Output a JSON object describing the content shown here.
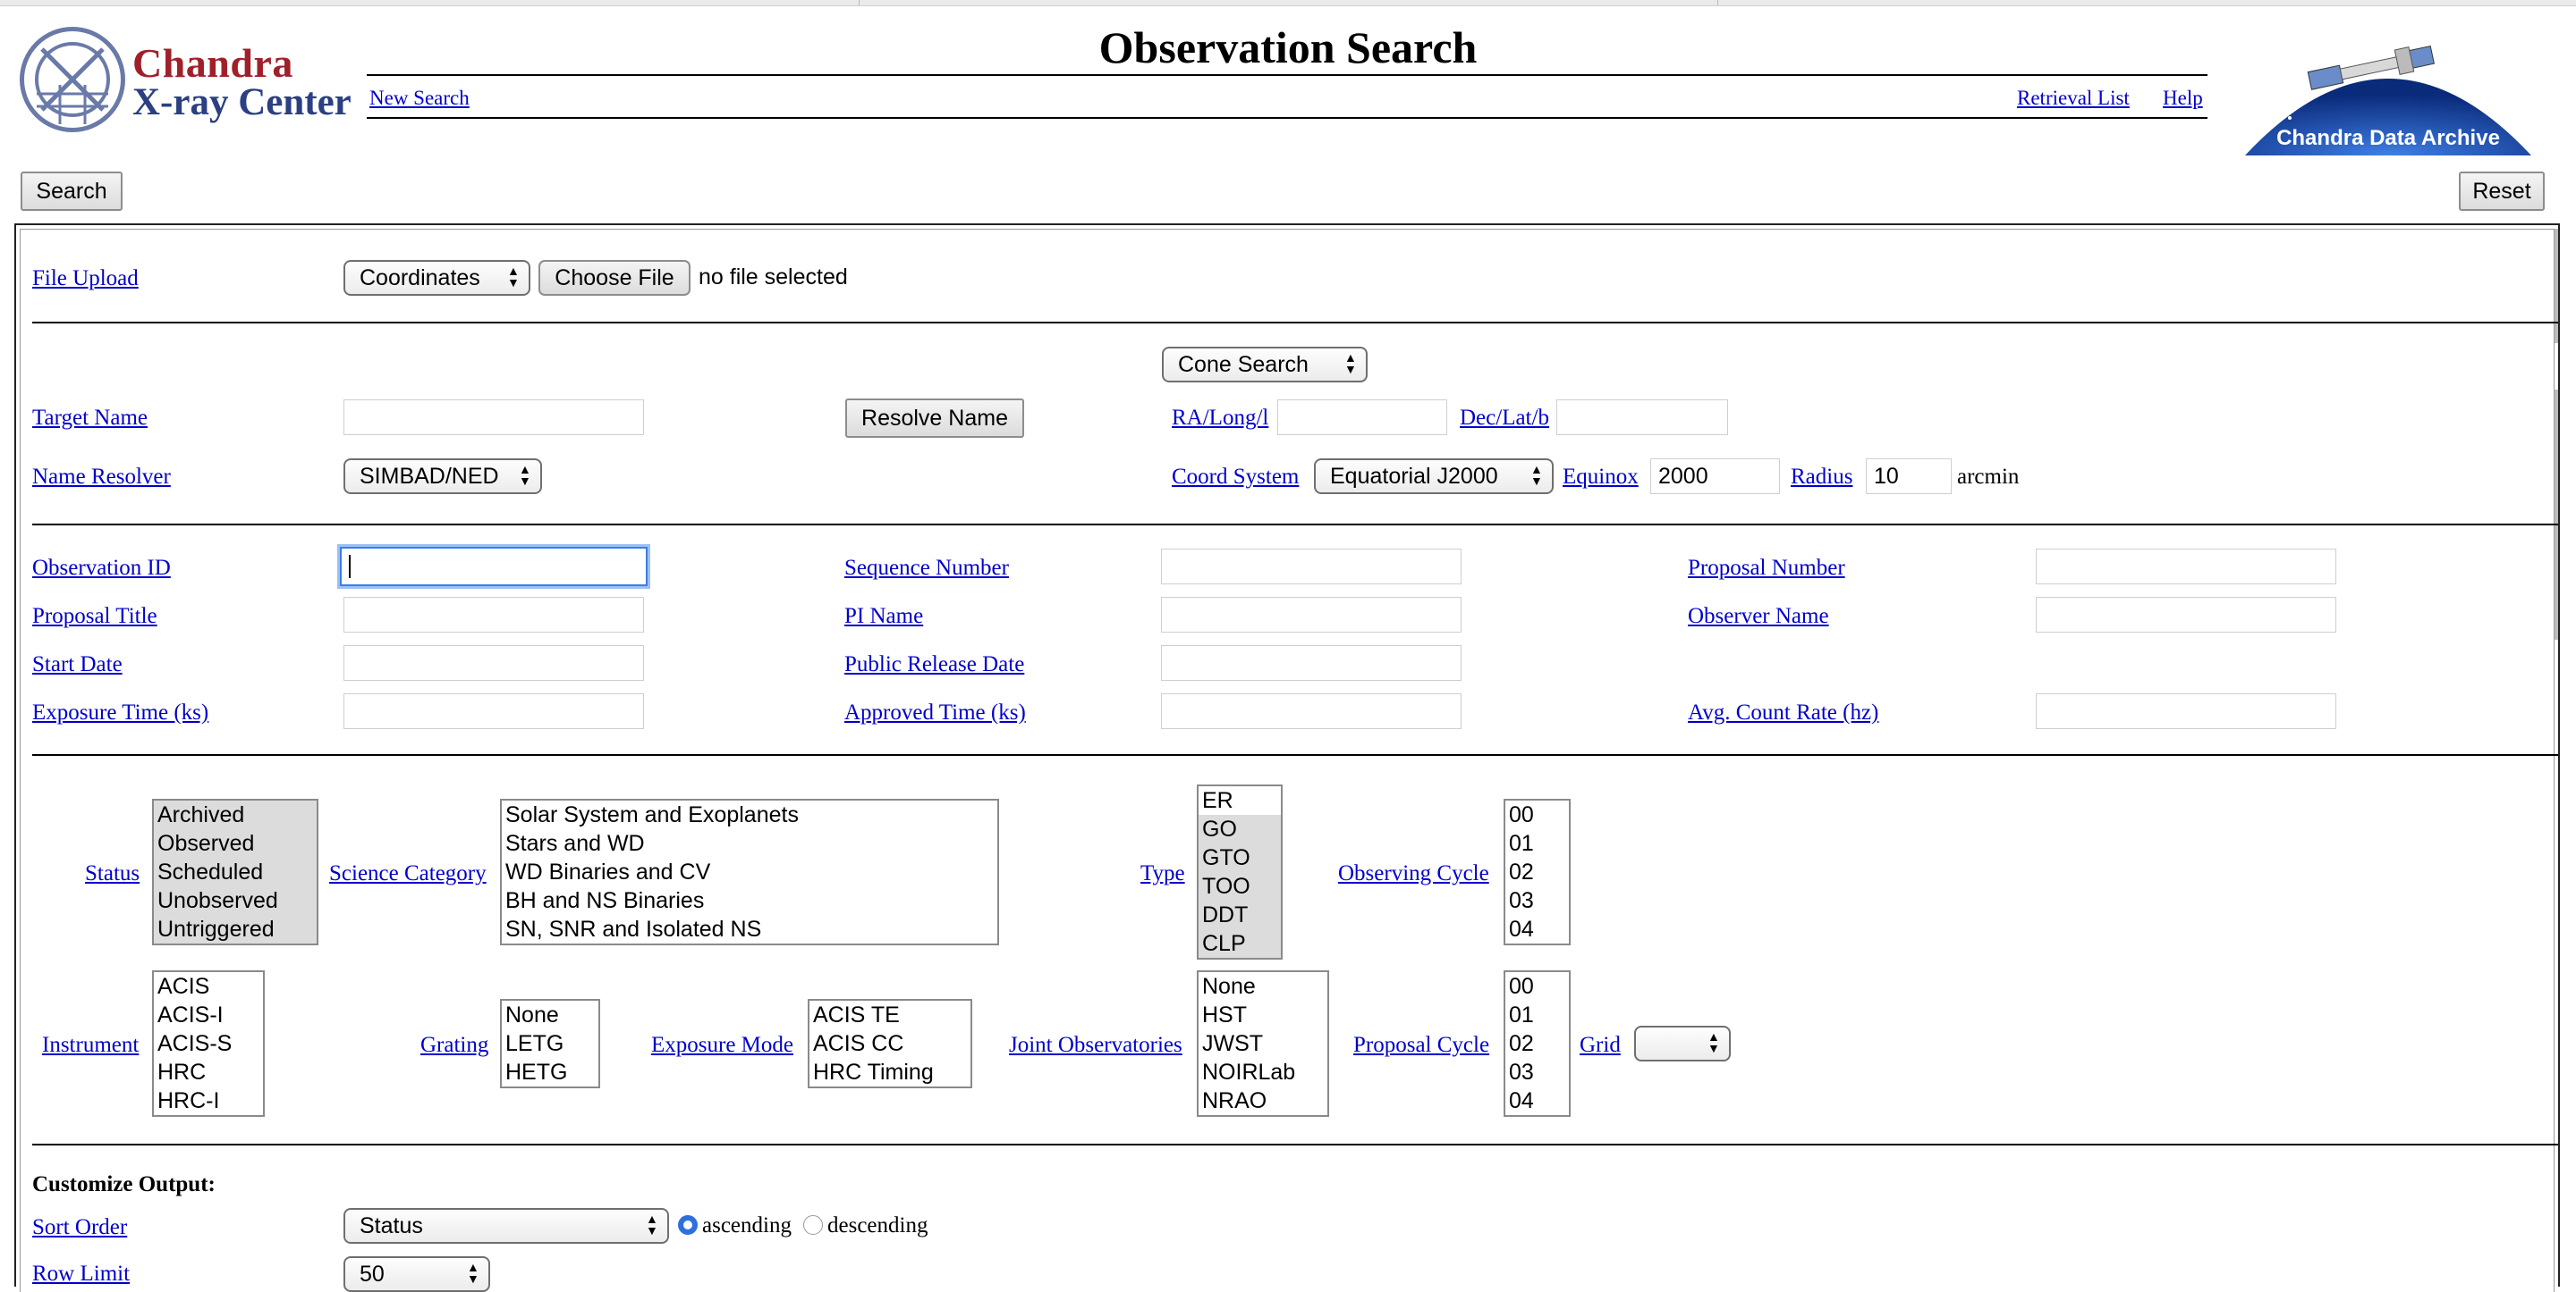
{
  "header": {
    "logo_line1": "Chandra",
    "logo_line2": "X-ray Center",
    "title": "Observation Search",
    "new_search": "New Search",
    "retrieval_list": "Retrieval List",
    "help": "Help",
    "archive_label": "Chandra Data Archive"
  },
  "actions": {
    "search": "Search",
    "reset": "Reset"
  },
  "upload": {
    "label": "File Upload",
    "type_select": "Coordinates",
    "choose_file": "Choose File",
    "file_status": "no file selected"
  },
  "target": {
    "search_mode": "Cone Search",
    "target_name_label": "Target Name",
    "target_name_value": "",
    "resolve_button": "Resolve Name",
    "ra_label": "RA/Long/l",
    "ra_value": "",
    "dec_label": "Dec/Lat/b",
    "dec_value": "",
    "name_resolver_label": "Name Resolver",
    "name_resolver_value": "SIMBAD/NED",
    "coord_system_label": "Coord System",
    "coord_system_value": "Equatorial J2000",
    "equinox_label": "Equinox",
    "equinox_value": "2000",
    "radius_label": "Radius",
    "radius_value": "10",
    "radius_unit": "arcmin"
  },
  "fields": {
    "observation_id": "Observation ID",
    "sequence_number": "Sequence Number",
    "proposal_number": "Proposal Number",
    "proposal_title": "Proposal Title",
    "pi_name": "PI Name",
    "observer_name": "Observer Name",
    "start_date": "Start Date",
    "public_release_date": "Public Release Date",
    "exposure_time": "Exposure Time (ks)",
    "approved_time": "Approved Time (ks)",
    "avg_count_rate": "Avg. Count Rate (hz)"
  },
  "lists": {
    "status_label": "Status",
    "status": [
      "Archived",
      "Observed",
      "Scheduled",
      "Unobserved",
      "Untriggered"
    ],
    "science_category_label": "Science Category",
    "science_category": [
      "Solar System and Exoplanets",
      "Stars and WD",
      "WD Binaries and CV",
      "BH and NS Binaries",
      "SN, SNR and Isolated NS"
    ],
    "type_label": "Type",
    "type": [
      "ER",
      "GO",
      "GTO",
      "TOO",
      "DDT",
      "CLP"
    ],
    "observing_cycle_label": "Observing Cycle",
    "observing_cycle": [
      "00",
      "01",
      "02",
      "03",
      "04"
    ],
    "instrument_label": "Instrument",
    "instrument": [
      "ACIS",
      "ACIS-I",
      "ACIS-S",
      "HRC",
      "HRC-I"
    ],
    "grating_label": "Grating",
    "grating": [
      "None",
      "LETG",
      "HETG"
    ],
    "exposure_mode_label": "Exposure Mode",
    "exposure_mode": [
      "ACIS TE",
      "ACIS CC",
      "HRC Timing"
    ],
    "joint_observatories_label": "Joint Observatories",
    "joint_observatories": [
      "None",
      "HST",
      "JWST",
      "NOIRLab",
      "NRAO"
    ],
    "proposal_cycle_label": "Proposal Cycle",
    "proposal_cycle": [
      "00",
      "01",
      "02",
      "03",
      "04"
    ],
    "grid_label": "Grid",
    "grid_value": ""
  },
  "output": {
    "heading": "Customize Output:",
    "sort_order_label": "Sort Order",
    "sort_order_value": "Status",
    "ascending": "ascending",
    "descending": "descending",
    "row_limit_label": "Row Limit",
    "row_limit_value": "50"
  },
  "colors": {
    "link": "#0000cc",
    "brand_red": "#a0202a",
    "brand_blue": "#2b3f82",
    "focus": "#3b7de8"
  }
}
